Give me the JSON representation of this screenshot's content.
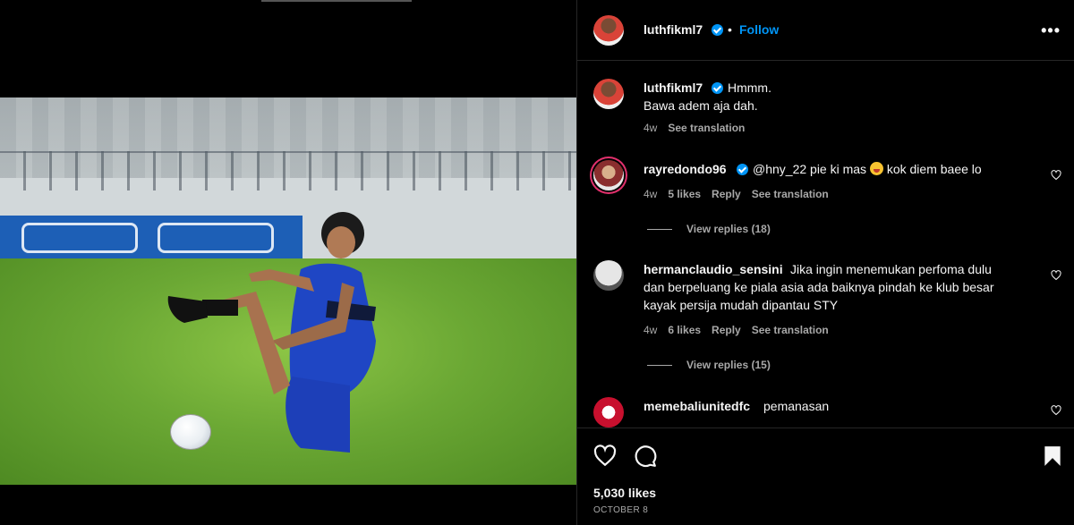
{
  "post": {
    "author": "luthfikml7",
    "follow_label": "Follow",
    "separator": "•",
    "more_label": "•••",
    "caption_line1": "Hmmm.",
    "caption_line2": "Bawa adem aja dah.",
    "caption_age": "4w",
    "see_translation": "See translation",
    "likes": "5,030 likes",
    "date": "October 8"
  },
  "comments": [
    {
      "username": "rayredondo96",
      "verified": true,
      "text_before": "@hny_22 pie ki mas ",
      "text_after": " kok diem baee lo",
      "age": "4w",
      "likes": "5 likes",
      "reply_label": "Reply",
      "translate_label": "See translation",
      "view_replies": "View replies (18)"
    },
    {
      "username": "hermanclaudio_sensini",
      "verified": false,
      "text_line1": "Jika ingin menemukan perfoma dulu",
      "text_line2": "dan berpeluang ke piala asia ada baiknya pindah ke klub besar",
      "text_line3": "kayak persija mudah dipantau STY",
      "age": "4w",
      "likes": "6 likes",
      "reply_label": "Reply",
      "translate_label": "See translation",
      "view_replies": "View replies (15)"
    },
    {
      "username": "memebaliunitedfc",
      "verified": false,
      "text": "pemanasan"
    }
  ],
  "icons": {
    "like": "heart-icon",
    "comment": "comment-bubble-icon",
    "save": "bookmark-icon",
    "verified": "verified-badge-icon",
    "more": "more-options-icon"
  },
  "colors": {
    "accent": "#0095f6",
    "background": "#000000",
    "muted": "#a8a8a8"
  }
}
